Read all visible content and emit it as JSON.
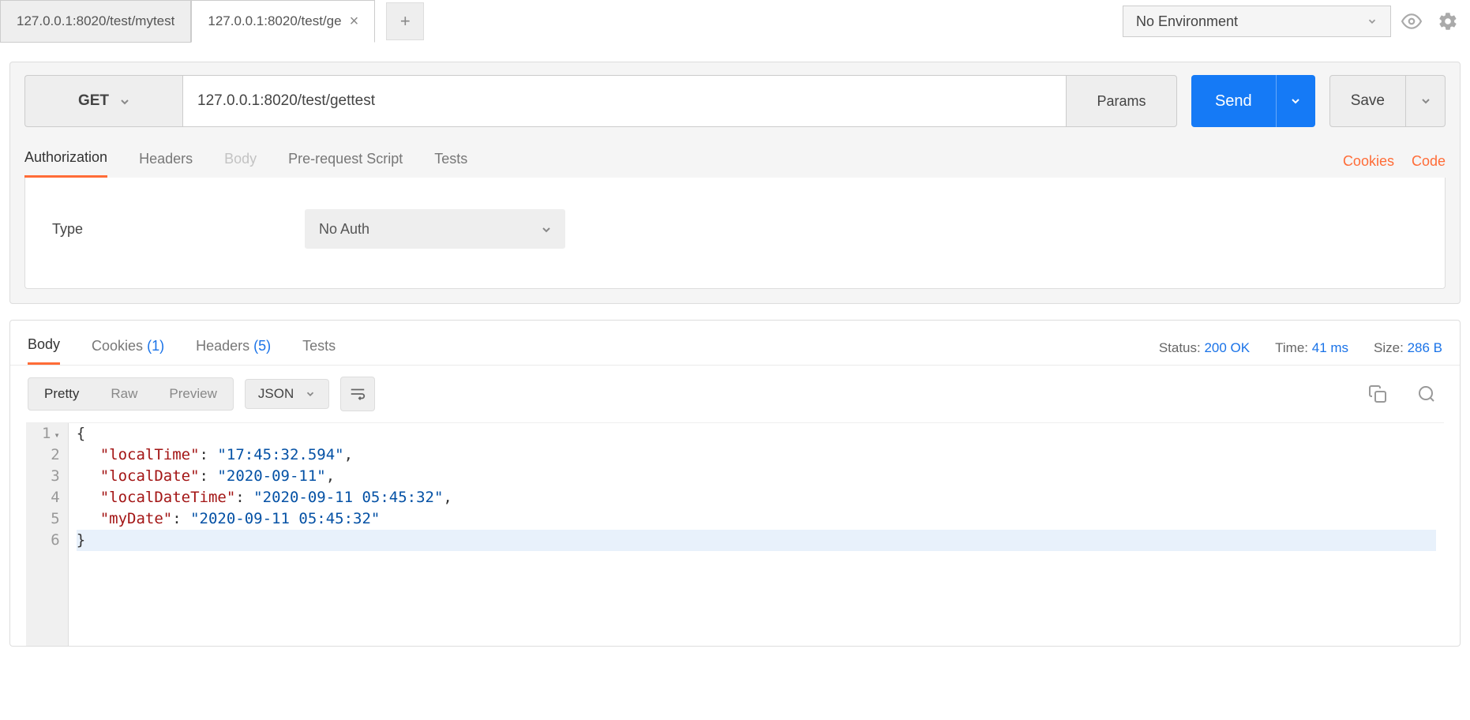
{
  "tabs": {
    "items": [
      {
        "label": "127.0.0.1:8020/test/mytest",
        "active": false
      },
      {
        "label": "127.0.0.1:8020/test/ge",
        "active": true
      }
    ]
  },
  "env": {
    "selected": "No Environment"
  },
  "request": {
    "method": "GET",
    "url": "127.0.0.1:8020/test/gettest",
    "params_label": "Params",
    "send_label": "Send",
    "save_label": "Save",
    "tabs": {
      "authorization": "Authorization",
      "headers": "Headers",
      "body": "Body",
      "pre_request_script": "Pre-request Script",
      "tests": "Tests"
    },
    "links": {
      "cookies": "Cookies",
      "code": "Code"
    },
    "auth": {
      "type_label": "Type",
      "selected": "No Auth"
    }
  },
  "response": {
    "tabs": {
      "body": "Body",
      "cookies_label": "Cookies",
      "cookies_count": "(1)",
      "headers_label": "Headers",
      "headers_count": "(5)",
      "tests": "Tests"
    },
    "meta": {
      "status_label": "Status:",
      "status_value": "200 OK",
      "time_label": "Time:",
      "time_value": "41 ms",
      "size_label": "Size:",
      "size_value": "286 B"
    },
    "view": {
      "pretty": "Pretty",
      "raw": "Raw",
      "preview": "Preview",
      "format": "JSON"
    },
    "json": {
      "localTime": "17:45:32.594",
      "localDate": "2020-09-11",
      "localDateTime": "2020-09-11 05:45:32",
      "myDate": "2020-09-11 05:45:32"
    }
  }
}
